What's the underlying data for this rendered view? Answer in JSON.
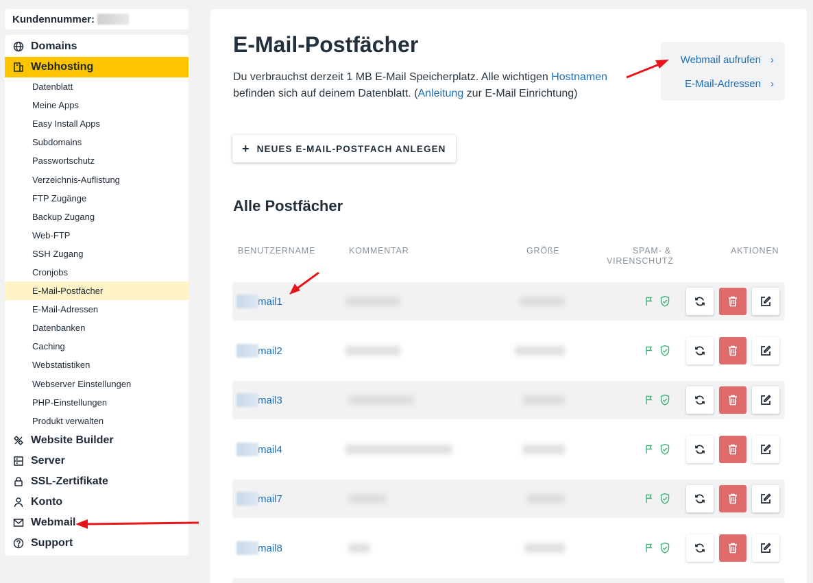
{
  "customer": {
    "label": "Kundennummer:"
  },
  "nav": {
    "top": [
      {
        "label": "Domains",
        "icon": "globe-icon"
      },
      {
        "label": "Webhosting",
        "icon": "hosting-icon"
      }
    ],
    "sub": [
      "Datenblatt",
      "Meine Apps",
      "Easy Install Apps",
      "Subdomains",
      "Passwortschutz",
      "Verzeichnis-Auflistung",
      "FTP Zugänge",
      "Backup Zugang",
      "Web-FTP",
      "SSH Zugang",
      "Cronjobs",
      "E-Mail-Postfächer",
      "E-Mail-Adressen",
      "Datenbanken",
      "Caching",
      "Webstatistiken",
      "Webserver Einstellungen",
      "PHP-Einstellungen",
      "Produkt verwalten"
    ],
    "bottom": [
      {
        "label": "Website Builder",
        "icon": "builder-icon"
      },
      {
        "label": "Server",
        "icon": "server-icon"
      },
      {
        "label": "SSL-Zertifikate",
        "icon": "lock-icon"
      },
      {
        "label": "Konto",
        "icon": "user-icon"
      },
      {
        "label": "Webmail",
        "icon": "mail-icon"
      },
      {
        "label": "Support",
        "icon": "help-icon"
      }
    ]
  },
  "main": {
    "title": "E-Mail-Postfächer",
    "intro": {
      "p1": "Du verbrauchst derzeit 1 MB E-Mail Speicherplatz. Alle wichtigen ",
      "link1": "Hostnamen",
      "p2": " befinden sich auf deinem Datenblatt. (",
      "link2": "Anleitung",
      "p3": " zur E-Mail Einrichtung)"
    },
    "quick": {
      "webmail": "Webmail aufrufen",
      "addresses": "E-Mail-Adressen",
      "chevron": "›"
    },
    "new_button": "NEUES E-MAIL-POSTFACH ANLEGEN",
    "list_title": "Alle Postfächer",
    "columns": {
      "user": "BENUTZERNAME",
      "comment": "KOMMENTAR",
      "size": "GRÖßE",
      "spam1": "SPAM- &",
      "spam2": "VIRENSCHUTZ",
      "actions": "AKTIONEN"
    },
    "rows": [
      {
        "user": "mail1"
      },
      {
        "user": "mail2"
      },
      {
        "user": "mail3"
      },
      {
        "user": "mail4"
      },
      {
        "user": "mail7"
      },
      {
        "user": "mail8"
      }
    ]
  },
  "colors": {
    "accent": "#fdc500",
    "active_sub": "#fff3c8",
    "link": "#1d6fb8",
    "danger": "#e06b6b",
    "safe": "#3cb371"
  }
}
